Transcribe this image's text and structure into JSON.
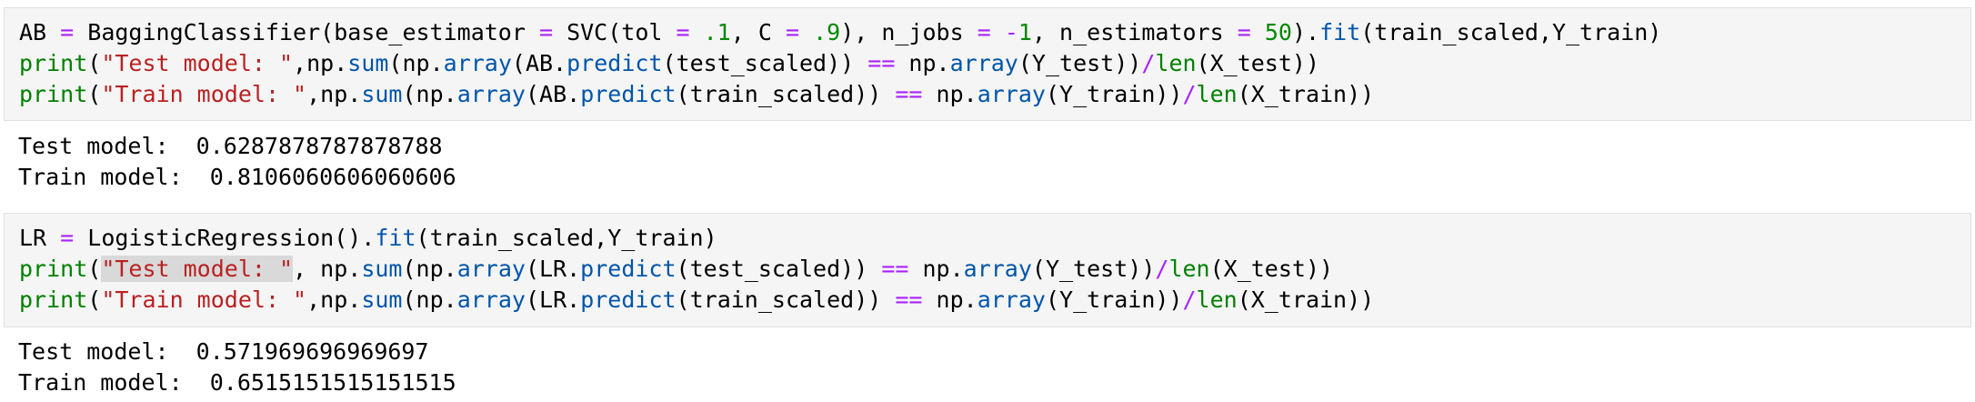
{
  "cells": [
    {
      "input": {
        "line1": {
          "p1": "AB ",
          "op1": "=",
          "p2": " BaggingClassifier(base_estimator ",
          "op2": "=",
          "p3": " SVC(tol ",
          "op3": "=",
          "p4": " ",
          "n1": ".1",
          "p5": ", C ",
          "op4": "=",
          "p6": " ",
          "n2": ".9",
          "p7": "), n_jobs ",
          "op5": "=",
          "p8": " ",
          "op6": "-",
          "n3": "1",
          "p9": ", n_estimators ",
          "op7": "=",
          "p10": " ",
          "n4": "50",
          "p11": ").",
          "fn1": "fit",
          "p12": "(train_scaled,Y_train)"
        },
        "line2": {
          "fn1": "print",
          "p1": "(",
          "s1": "\"Test model: \"",
          "p2": ",np.",
          "fn2": "sum",
          "p3": "(np.",
          "fn3": "array",
          "p4": "(AB.",
          "fn4": "predict",
          "p5": "(test_scaled)) ",
          "op1": "==",
          "p6": " np.",
          "fn5": "array",
          "p7": "(Y_test))",
          "op2": "/",
          "fn6": "len",
          "p8": "(X_test))"
        },
        "line3": {
          "fn1": "print",
          "p1": "(",
          "s1": "\"Train model: \"",
          "p2": ",np.",
          "fn2": "sum",
          "p3": "(np.",
          "fn3": "array",
          "p4": "(AB.",
          "fn4": "predict",
          "p5": "(train_scaled)) ",
          "op1": "==",
          "p6": " np.",
          "fn5": "array",
          "p7": "(Y_train))",
          "op2": "/",
          "fn6": "len",
          "p8": "(X_train))"
        }
      },
      "output": {
        "line1": "Test model:  0.6287878787878788",
        "line2": "Train model:  0.8106060606060606"
      }
    },
    {
      "input": {
        "line1": {
          "p1": "LR ",
          "op1": "=",
          "p2": " LogisticRegression().",
          "fn1": "fit",
          "p3": "(train_scaled,Y_train)"
        },
        "line2": {
          "fn1": "print",
          "p1": "(",
          "s1": "\"Test model: \"",
          "p2": ", np.",
          "fn2": "sum",
          "p3": "(np.",
          "fn3": "array",
          "p4": "(LR.",
          "fn4": "predict",
          "p5": "(test_scaled)) ",
          "op1": "==",
          "p6": " np.",
          "fn5": "array",
          "p7": "(Y_test))",
          "op2": "/",
          "fn6": "len",
          "p8": "(X_test))"
        },
        "line3": {
          "fn1": "print",
          "p1": "(",
          "s1": "\"Train model: \"",
          "p2": ",np.",
          "fn2": "sum",
          "p3": "(np.",
          "fn3": "array",
          "p4": "(LR.",
          "fn4": "predict",
          "p5": "(train_scaled)) ",
          "op1": "==",
          "p6": " np.",
          "fn5": "array",
          "p7": "(Y_train))",
          "op2": "/",
          "fn6": "len",
          "p8": "(X_train))"
        }
      },
      "output": {
        "line1": "Test model:  0.571969696969697",
        "line2": "Train model:  0.6515151515151515"
      }
    }
  ],
  "colors": {
    "operator": "#aa22ff",
    "number": "#008800",
    "string": "#ba2121",
    "builtin": "#008000",
    "attribute": "#0055aa",
    "cell_background": "#f5f5f5",
    "selection": "#d9d9d9"
  }
}
